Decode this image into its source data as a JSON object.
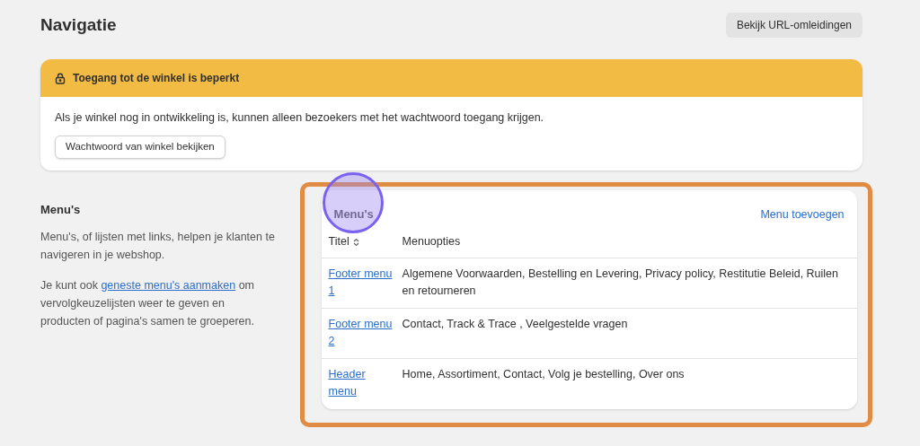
{
  "page": {
    "title": "Navigatie",
    "header_button": "Bekijk URL-omleidingen"
  },
  "banner": {
    "title": "Toegang tot de winkel is beperkt",
    "text": "Als je winkel nog in ontwikkeling is, kunnen alleen bezoekers met het wachtwoord toegang krijgen.",
    "button": "Wachtwoord van winkel bekijken"
  },
  "section": {
    "title": "Menu's",
    "description": "Menu's, of lijsten met links, helpen je klanten te navigeren in je webshop.",
    "note_before": "Je kunt ook",
    "note_link": "geneste menu's aanmaken",
    "note_after": "om vervolgkeuzelijsten weer te geven en producten of pagina's samen te groeperen."
  },
  "card": {
    "title": "Menu's",
    "add_link": "Menu toevoegen",
    "columns": [
      "Titel",
      "Menuopties"
    ],
    "rows": [
      {
        "title": "Footer menu 1",
        "options": "Algemene Voorwaarden, Bestelling en Levering, Privacy policy, Restitutie Beleid, Ruilen en retourneren"
      },
      {
        "title": "Footer menu 2",
        "options": "Contact, Track & Trace , Veelgestelde vragen"
      },
      {
        "title": "Header menu",
        "options": "Home, Assortiment, Contact, Volg je bestelling, Over ons"
      }
    ]
  }
}
